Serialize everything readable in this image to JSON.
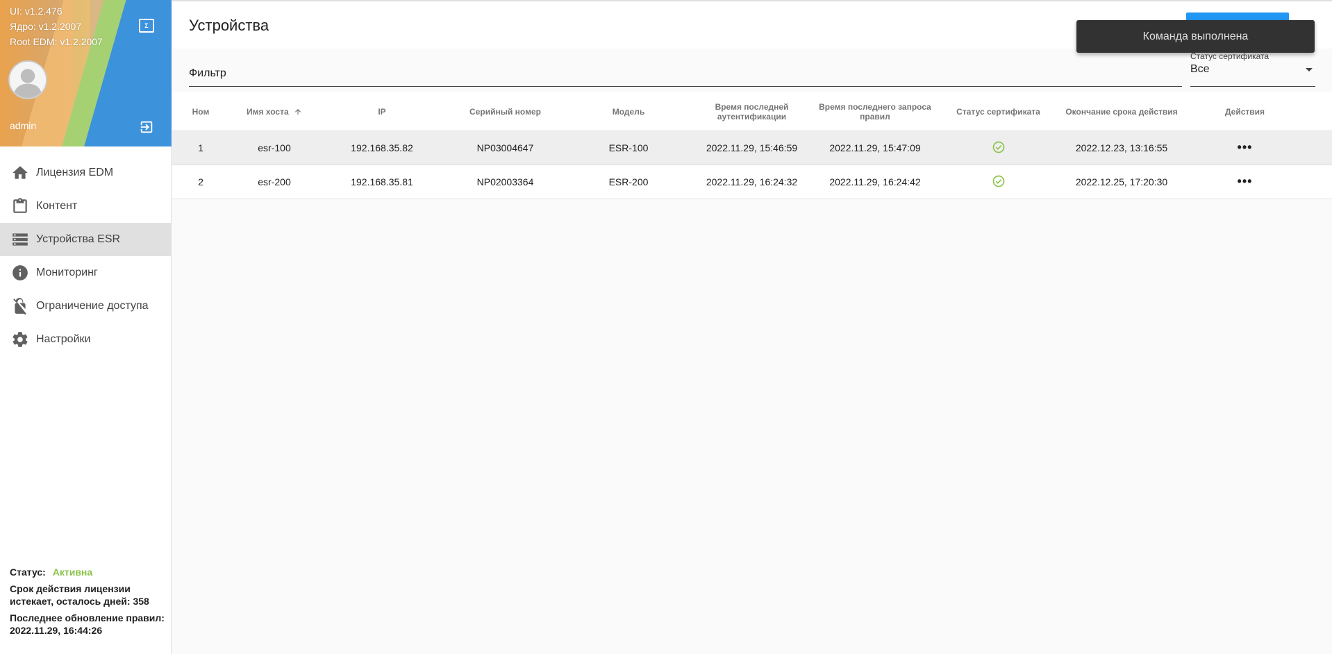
{
  "sidebar": {
    "versions": {
      "ui": "UI: v1.2.476",
      "core": "Ядро: v1.2.2007",
      "root": "Root EDM: v1.2.2007"
    },
    "version_icon_label": "Σ",
    "username": "admin",
    "items": [
      {
        "label": "Лицензия EDM",
        "icon": "home-icon"
      },
      {
        "label": "Контент",
        "icon": "clipboard-icon"
      },
      {
        "label": "Устройства ESR",
        "icon": "server-icon",
        "active": true
      },
      {
        "label": "Мониторинг",
        "icon": "info-icon"
      },
      {
        "label": "Ограничение доступа",
        "icon": "lock-off-icon"
      },
      {
        "label": "Настройки",
        "icon": "gear-icon"
      }
    ],
    "license": {
      "status_label": "Статус:",
      "status_value": "Активна",
      "expiry": "Срок действия лицензии истекает, осталось дней: 358",
      "last_update": "Последнее обновление правил: 2022.11.29, 16:44:26"
    }
  },
  "header": {
    "title": "Устройства"
  },
  "toast": {
    "message": "Команда выполнена"
  },
  "filter": {
    "placeholder": "Фильтр",
    "cert_status_label": "Статус сертификата",
    "cert_status_value": "Все"
  },
  "table": {
    "columns": [
      "Ном",
      "Имя хоста",
      "IP",
      "Серийный номер",
      "Модель",
      "Время последней аутентификации",
      "Время последнего запроса правил",
      "Статус сертификата",
      "Окончание срока действия",
      "Действия"
    ],
    "rows": [
      {
        "num": "1",
        "host": "esr-100",
        "ip": "192.168.35.82",
        "serial": "NP03004647",
        "model": "ESR-100",
        "last_auth": "2022.11.29, 15:46:59",
        "last_rules": "2022.11.29, 15:47:09",
        "cert_ok": true,
        "expiry": "2022.12.23, 13:16:55",
        "actions": "•••"
      },
      {
        "num": "2",
        "host": "esr-200",
        "ip": "192.168.35.81",
        "serial": "NP02003364",
        "model": "ESR-200",
        "last_auth": "2022.11.29, 16:24:32",
        "last_rules": "2022.11.29, 16:24:42",
        "cert_ok": true,
        "expiry": "2022.12.25, 17:20:30",
        "actions": "•••"
      }
    ]
  },
  "colors": {
    "accent": "#2196f3",
    "status_active": "#8bc34a",
    "cert_ok": "#8bc34a",
    "toast_bg": "#323232"
  }
}
